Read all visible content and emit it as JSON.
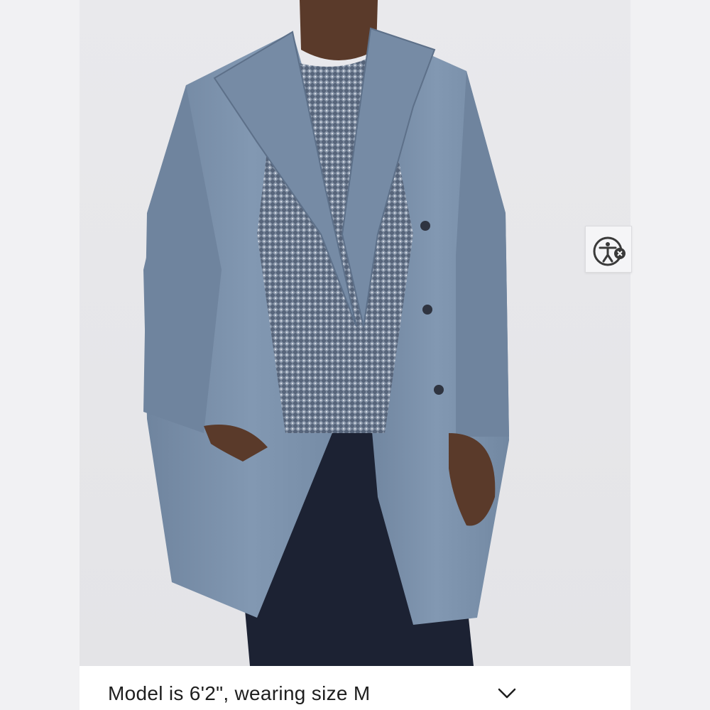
{
  "product_image": {
    "alt": "Model wearing a blue wool double-breasted overcoat over a knit sweater and dark jeans"
  },
  "caption": {
    "text": "Model is 6'2\", wearing size M",
    "toggle_icon": "chevron-down-icon"
  },
  "accessibility_widget": {
    "icon": "accessibility-icon",
    "badge_icon": "close-icon"
  },
  "colors": {
    "coat": "#7d93ad",
    "sweater": "#5f6d80",
    "jeans": "#1c2233",
    "background": "#f1f1f3"
  }
}
